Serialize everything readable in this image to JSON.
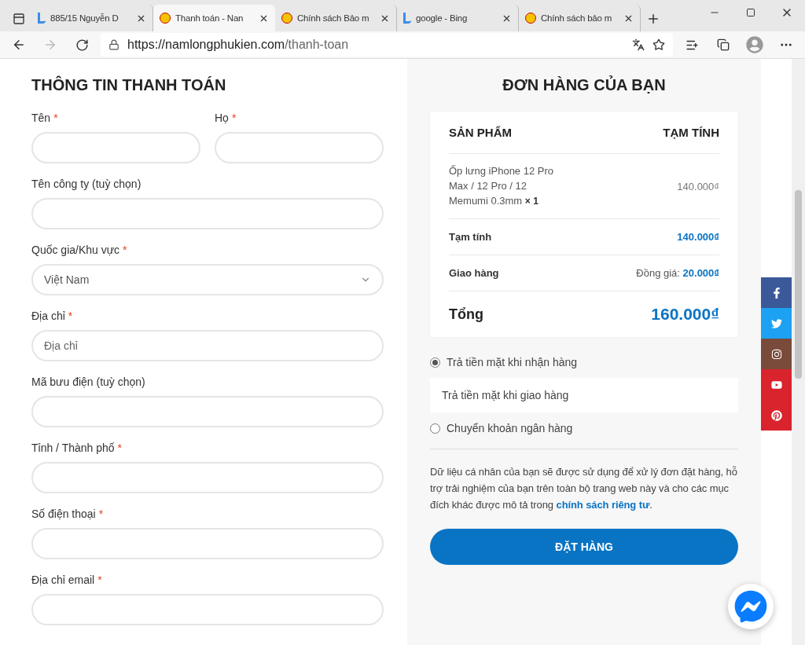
{
  "browser": {
    "tabs": [
      {
        "title": "885/15 Nguyễn D",
        "kind": "search",
        "selected": false
      },
      {
        "title": "Thanh toán - Nan",
        "kind": "shop",
        "selected": true
      },
      {
        "title": "Chính sách Bảo m",
        "kind": "shop",
        "selected": false
      },
      {
        "title": "google - Bing",
        "kind": "search",
        "selected": false
      },
      {
        "title": "Chính sách bảo m",
        "kind": "shop",
        "selected": false
      }
    ],
    "address": {
      "host": "https://namlongphukien.com",
      "path": "/thanh-toan"
    }
  },
  "billing": {
    "title": "THÔNG TIN THANH TOÁN",
    "rows": [
      [
        {
          "label": "Tên",
          "required_mark": "*",
          "kind": "text"
        },
        {
          "label": "Họ",
          "required_mark": "*",
          "kind": "text"
        }
      ],
      [
        {
          "label": "Tên công ty (tuỳ chọn)",
          "kind": "text"
        }
      ],
      [
        {
          "label": "Quốc gia/Khu vực",
          "required_mark": "*",
          "kind": "select",
          "value": "Việt Nam"
        }
      ],
      [
        {
          "label": "Địa chỉ",
          "required_mark": "*",
          "kind": "text",
          "placeholder": "Địa chỉ"
        }
      ],
      [
        {
          "label": "Mã bưu điện (tuỳ chọn)",
          "kind": "text"
        }
      ],
      [
        {
          "label": "Tỉnh / Thành phố",
          "required_mark": "*",
          "kind": "text"
        }
      ],
      [
        {
          "label": "Số điện thoại",
          "required_mark": "*",
          "kind": "text"
        }
      ],
      [
        {
          "label": "Địa chỉ email",
          "required_mark": "*",
          "kind": "text"
        }
      ]
    ]
  },
  "order": {
    "title": "ĐƠN HÀNG CỦA BẠN",
    "columns": [
      "SẢN PHẨM",
      "TẠM TÍNH"
    ],
    "item": {
      "name": "Ốp lưng iPhone 12 Pro Max / 12 Pro / 12 Memumi 0.3mm",
      "qty": "× 1",
      "price": "140.000₫"
    },
    "rows": [
      {
        "label": "Tạm tính",
        "value": "140.000₫"
      },
      {
        "label": "Giao hàng",
        "prefix": "Đồng giá:",
        "value": "20.000₫"
      }
    ],
    "total": {
      "label": "Tổng",
      "value": "160.000₫"
    }
  },
  "payment": [
    {
      "label": "Trả tiền mặt khi nhận hàng",
      "selected": true,
      "description": "Trả tiền mặt khi giao hàng"
    },
    {
      "label": "Chuyển khoản ngân hàng",
      "selected": false
    }
  ],
  "privacy": {
    "text": "Dữ liệu cá nhân của bạn sẽ được sử dụng để xử lý đơn đặt hàng, hỗ trợ trải nghiệm của bạn trên toàn bộ trang web này và cho các mục đích khác được mô tả trong ",
    "link": "chính sách riêng tư",
    "end": "."
  },
  "submit": "ĐẶT HÀNG",
  "social": [
    {
      "kind": "facebook",
      "color": "#3b5998"
    },
    {
      "kind": "twitter",
      "color": "#1da1f2"
    },
    {
      "kind": "instagram",
      "color": "#7a4a3a"
    },
    {
      "kind": "youtube",
      "color": "#d9232d"
    },
    {
      "kind": "pinterest",
      "color": "#d9232d"
    }
  ]
}
